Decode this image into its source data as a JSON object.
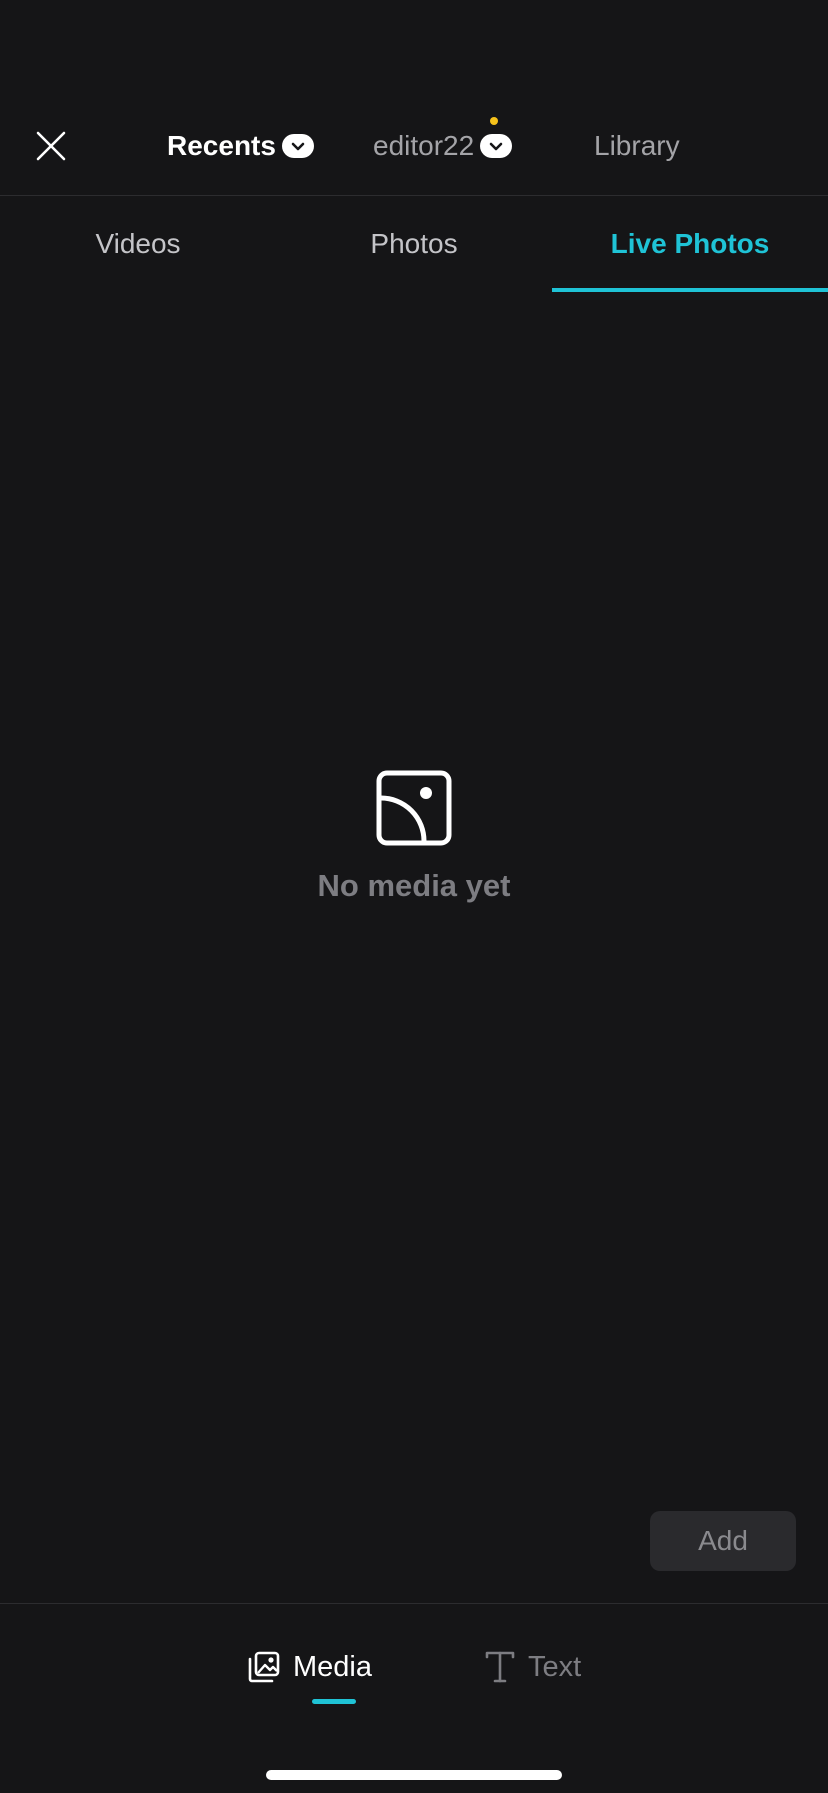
{
  "header": {
    "sources": [
      {
        "label": "Recents",
        "has_dropdown": true,
        "active": true
      },
      {
        "label": "editor22",
        "has_dropdown": true,
        "has_notification": true,
        "active": false
      },
      {
        "label": "Library",
        "has_dropdown": false,
        "active": false
      }
    ]
  },
  "type_tabs": [
    {
      "label": "Videos",
      "active": false
    },
    {
      "label": "Photos",
      "active": false
    },
    {
      "label": "Live Photos",
      "active": true
    }
  ],
  "empty_state": {
    "icon": "image-placeholder-icon",
    "text": "No media yet"
  },
  "add_button": {
    "label": "Add"
  },
  "bottom_tabs": [
    {
      "label": "Media",
      "icon": "media-gallery-icon",
      "active": true
    },
    {
      "label": "Text",
      "icon": "text-t-icon",
      "active": false
    }
  ],
  "colors": {
    "background": "#151517",
    "accent": "#1fc3d6",
    "notification": "#f6c21b",
    "muted_text": "#7d7d82"
  }
}
